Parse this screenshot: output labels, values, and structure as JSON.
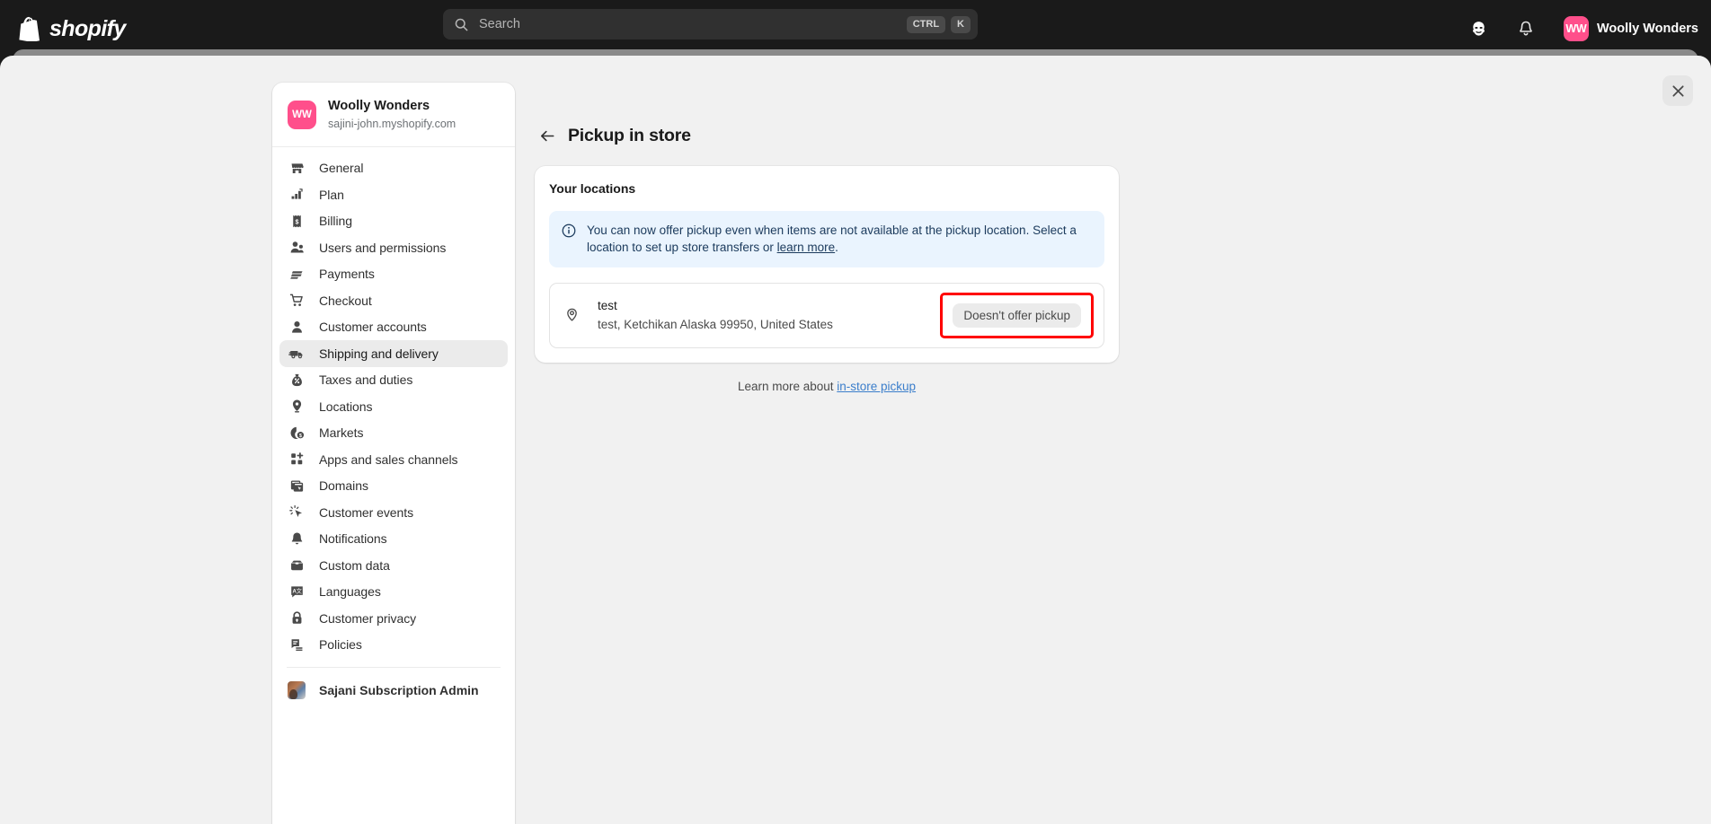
{
  "topbar": {
    "brand": "shopify",
    "search": {
      "placeholder": "Search",
      "kbd_ctrl": "CTRL",
      "kbd_key": "K"
    },
    "help_icon": "profile-face-icon",
    "bell_icon": "bell-icon",
    "user": {
      "initials": "WW",
      "name": "Woolly Wonders"
    }
  },
  "close_label": "close",
  "sidebar": {
    "shop": {
      "initials": "WW",
      "name": "Woolly Wonders",
      "domain": "sajini-john.myshopify.com"
    },
    "items": [
      {
        "label": "General",
        "icon": "store-icon",
        "active": false
      },
      {
        "label": "Plan",
        "icon": "chart-up-icon",
        "active": false
      },
      {
        "label": "Billing",
        "icon": "receipt-dollar-icon",
        "active": false
      },
      {
        "label": "Users and permissions",
        "icon": "users-key-icon",
        "active": false
      },
      {
        "label": "Payments",
        "icon": "payments-card-icon",
        "active": false
      },
      {
        "label": "Checkout",
        "icon": "cart-icon",
        "active": false
      },
      {
        "label": "Customer accounts",
        "icon": "person-icon",
        "active": false
      },
      {
        "label": "Shipping and delivery",
        "icon": "delivery-truck-icon",
        "active": true
      },
      {
        "label": "Taxes and duties",
        "icon": "tax-bag-icon",
        "active": false
      },
      {
        "label": "Locations",
        "icon": "location-pin-icon",
        "active": false
      },
      {
        "label": "Markets",
        "icon": "globe-dollar-icon",
        "active": false
      },
      {
        "label": "Apps and sales channels",
        "icon": "apps-grid-plus-icon",
        "active": false
      },
      {
        "label": "Domains",
        "icon": "domains-window-icon",
        "active": false
      },
      {
        "label": "Customer events",
        "icon": "cursor-click-icon",
        "active": false
      },
      {
        "label": "Notifications",
        "icon": "bell-icon",
        "active": false
      },
      {
        "label": "Custom data",
        "icon": "database-box-icon",
        "active": false
      },
      {
        "label": "Languages",
        "icon": "translate-icon",
        "active": false
      },
      {
        "label": "Customer privacy",
        "icon": "lock-icon",
        "active": false
      },
      {
        "label": "Policies",
        "icon": "policies-doc-icon",
        "active": false
      }
    ],
    "app": {
      "label": "Sajani Subscription Admin",
      "icon": "app-thumbnail"
    }
  },
  "main": {
    "back_icon": "arrow-left-icon",
    "title": "Pickup in store",
    "card_title": "Your locations",
    "banner": {
      "icon": "info-circle-icon",
      "text_before": "You can now offer pickup even when items are not available at the pickup location. Select a location to set up store transfers or ",
      "link": "learn more",
      "text_after": "."
    },
    "location": {
      "pin_icon": "location-pin-icon",
      "name": "test",
      "address": "test, Ketchikan Alaska 99950, United States",
      "badge": "Doesn't offer pickup",
      "badge_highlighted": true
    },
    "footer": {
      "text_before": "Learn more about ",
      "link": "in-store pickup"
    }
  },
  "colors": {
    "topbar_bg": "#1a1a1a",
    "modal_bg": "#f1f1f1",
    "brand_pink": "#ff4f8b",
    "banner_bg": "#eaf4fe",
    "banner_text": "#1b3a5c",
    "link_blue": "#3b7ecb",
    "highlight_red": "#ff0000",
    "active_nav_bg": "#ebebeb"
  }
}
